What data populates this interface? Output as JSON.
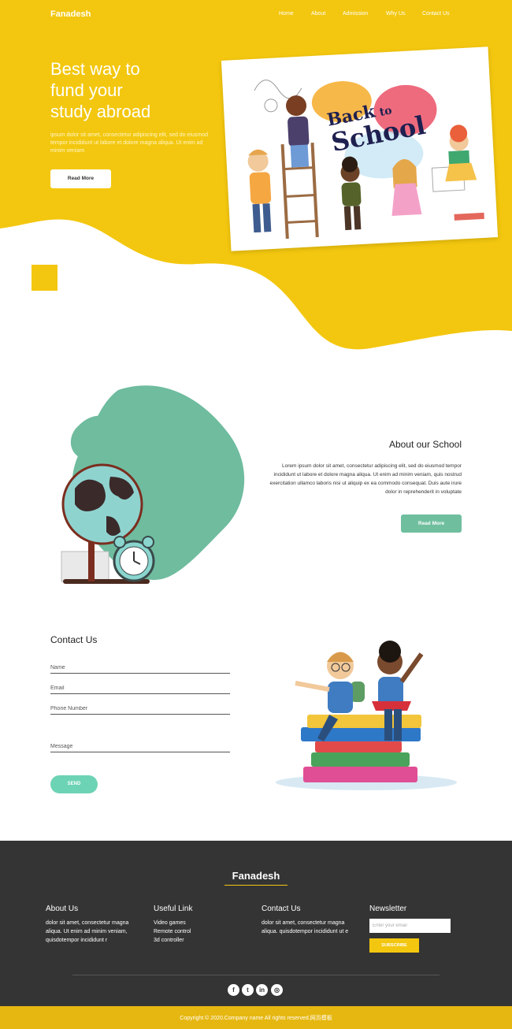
{
  "header": {
    "brand": "Fanadesh",
    "nav": [
      "Home",
      "About",
      "Admission",
      "Why Us",
      "Contact Us"
    ]
  },
  "hero": {
    "title_lines": [
      "Best way to",
      "fund your",
      "study abroad"
    ],
    "text": "ipsum dolor sit amet, consectetur adipiscing elit, sed do eiusmod tempor incididunt ut labore et dolore magna aliqua. Ut enim ad minim veniam",
    "button": "Read More",
    "illustration_title": [
      "Back",
      "to",
      "School"
    ]
  },
  "about": {
    "title": "About our School",
    "text": "Lorem ipsum dolor sit amet, consectetur adipiscing elit, sed do eiusmod tempor incididunt ut labore et dolore magna aliqua. Ut enim ad minim veniam, quis nostrud exercitation ullamco laboris nisi ut aliquip ex ea commodo consequat. Duis aute irure dolor in reprehenderit in voluptate",
    "button": "Read More"
  },
  "contact": {
    "title": "Contact Us",
    "placeholders": {
      "name": "Name",
      "email": "Email",
      "phone": "Phone Number",
      "message": "Message"
    },
    "button": "SEND"
  },
  "footer": {
    "brand": "Fanadesh",
    "about": {
      "title": "About Us",
      "text": "dolor sit amet, consectetur magna aliqua. Ut enim ad minim veniam, quisdotempor incididunt r"
    },
    "useful": {
      "title": "Useful Link",
      "links": [
        "Video games",
        "Remote control",
        "3d controller"
      ]
    },
    "contact": {
      "title": "Contact Us",
      "text": "dolor sit amet, consectetur magna aliqua. quisdotempor incididunt ut e"
    },
    "newsletter": {
      "title": "Newsletter",
      "placeholder": "Enter your email",
      "button": "SUBSCRIBE"
    },
    "social": [
      "facebook-icon",
      "twitter-icon",
      "linkedin-icon",
      "instagram-icon"
    ],
    "copyright": "Copyright © 2020.Company name All rights reserved.网页模板"
  },
  "colors": {
    "yellow": "#f3c70f",
    "yellow_dark": "#e6b711",
    "green": "#6fbf9f",
    "mint": "#6dd3b5",
    "footer_bg": "#343434"
  }
}
